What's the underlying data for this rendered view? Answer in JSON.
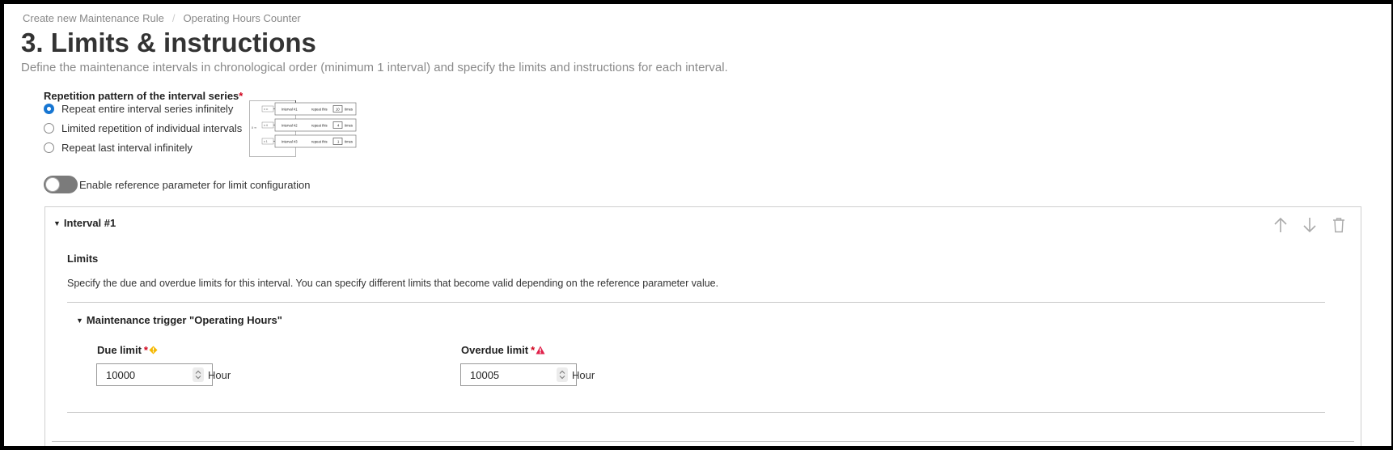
{
  "breadcrumb": {
    "items": [
      "Create new Maintenance Rule",
      "Operating Hours Counter"
    ]
  },
  "page": {
    "title": "3. Limits & instructions",
    "description": "Define the maintenance intervals in chronological order (minimum 1 interval) and specify the limits and instructions for each interval."
  },
  "repetition": {
    "label": "Repetition pattern of the interval series",
    "required_mark": "*",
    "options": [
      {
        "label": "Repeat entire interval series infinitely",
        "selected": true
      },
      {
        "label": "Limited repetition of individual intervals",
        "selected": false
      },
      {
        "label": "Repeat last interval infinitely",
        "selected": false
      }
    ],
    "diagram": {
      "rows": [
        {
          "loop": "x ∞",
          "interval": "Interval #1",
          "repeat": "repeat this",
          "count": "10",
          "times": "times"
        },
        {
          "loop": "x 4",
          "interval": "Interval #2",
          "repeat": "repeat this",
          "count": "4",
          "times": "times"
        },
        {
          "loop": "x 1",
          "interval": "Interval #3",
          "repeat": "repeat this",
          "count": "1",
          "times": "times"
        }
      ],
      "outer_loop": "x ∞"
    }
  },
  "reference_toggle": {
    "label": "Enable reference parameter for limit configuration",
    "enabled": false
  },
  "interval": {
    "title": "Interval #1",
    "actions": [
      "arrow-up-icon",
      "arrow-down-icon",
      "trash-icon"
    ],
    "limits_title": "Limits",
    "limits_description": "Specify the due and overdue limits for this interval. You can specify different limits that become valid depending on the reference parameter value.",
    "trigger_title": "Maintenance trigger \"Operating Hours\"",
    "due": {
      "label": "Due limit",
      "required_mark": "*",
      "value": "10000",
      "unit": "Hour",
      "status_color": "#f5b800"
    },
    "overdue": {
      "label": "Overdue limit",
      "required_mark": "*",
      "value": "10005",
      "unit": "Hour",
      "status_color": "#e0204a"
    }
  },
  "colors": {
    "accent": "#1776d2",
    "required": "#d0021b"
  }
}
